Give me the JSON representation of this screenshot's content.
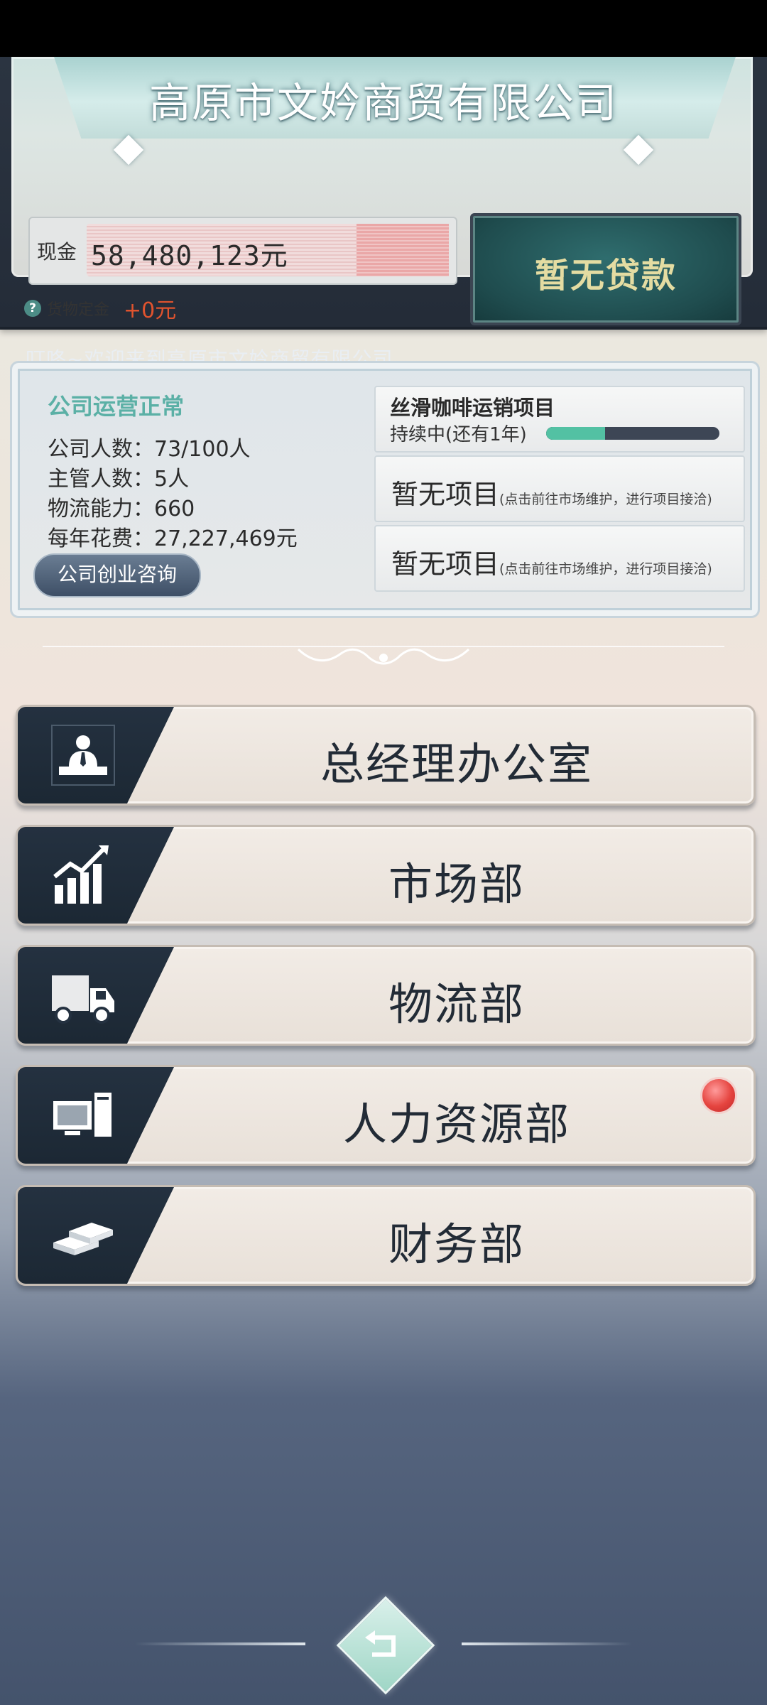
{
  "header": {
    "company_name": "高原市文妗商贸有限公司",
    "cash_label": "现金",
    "cash_value": "58,480,123元",
    "deposit_label": "货物定金",
    "deposit_value": "+0元",
    "loan_button": "暂无贷款",
    "marquee": "叮咚~欢迎来到高原市文妗商贸有限公司"
  },
  "status": {
    "operation_status": "公司运营正常",
    "employees": "公司人数：73/100人",
    "managers": "主管人数：5人",
    "logistics": "物流能力：660",
    "annual_cost": "每年花费：27,227,469元",
    "consult_button": "公司创业咨询"
  },
  "projects": [
    {
      "title": "丝滑咖啡运销项目",
      "status": "持续中(还有1年)",
      "progress": 0.34
    },
    {
      "title": "暂无项目",
      "hint": "(点击前往市场维护，进行项目接洽)"
    },
    {
      "title": "暂无项目",
      "hint": "(点击前往市场维护，进行项目接洽)"
    }
  ],
  "departments": [
    {
      "label": "总经理办公室",
      "icon": "manager-desk-icon"
    },
    {
      "label": "市场部",
      "icon": "chart-growth-icon"
    },
    {
      "label": "物流部",
      "icon": "truck-icon"
    },
    {
      "label": "人力资源部",
      "icon": "computer-icon",
      "notification": true
    },
    {
      "label": "财务部",
      "icon": "money-stack-icon"
    }
  ],
  "colors": {
    "accent_teal": "#53c1a3",
    "status_green": "#5bb0a6",
    "deposit_red": "#e0532e",
    "notification_red": "#e5443f"
  }
}
